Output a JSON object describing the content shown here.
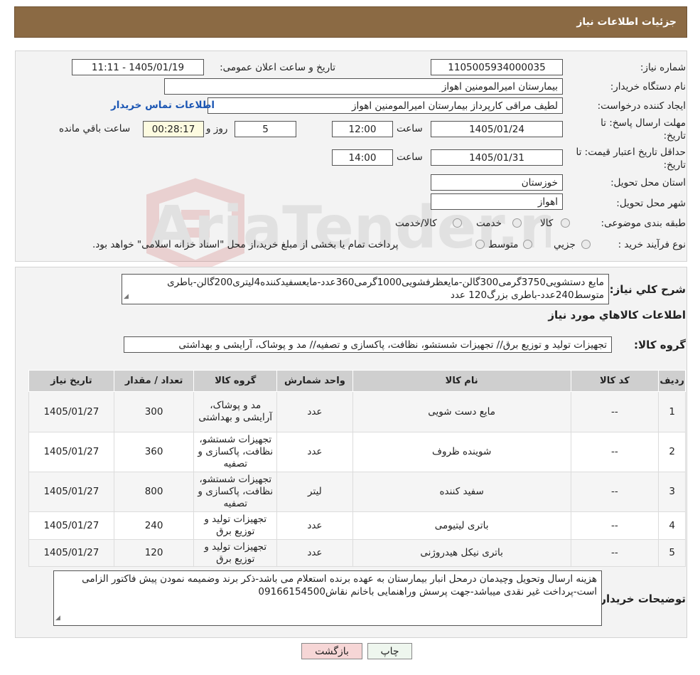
{
  "header": {
    "title": "جزئیات اطلاعات نیاز"
  },
  "form": {
    "need_number_label": "شماره نیاز:",
    "need_number": "1105005934000035",
    "announce_label": "تاریخ و ساعت اعلان عمومی:",
    "announce_value": "1405/01/19 - 11:11",
    "buyer_org_label": "نام دستگاه خریدار:",
    "buyer_org": "بیمارستان امیرالمومنین اهواز",
    "creator_label": "ایجاد کننده درخواست:",
    "creator": "لطیف مراقی کارپرداز بیمارستان امیرالمومنین اهواز",
    "contact_link": "اطلاعات تماس خریدار",
    "deadline_label_1": "مهلت ارسال پاسخ: تا",
    "deadline_label_2": "تاریخ:",
    "deadline_date": "1405/01/24",
    "time_label": "ساعت",
    "deadline_time": "12:00",
    "days_value": "5",
    "days_label": "روز و",
    "remaining_time": "00:28:17",
    "remaining_label": "ساعت باقي مانده",
    "validity_label_1": "حداقل تاریخ اعتبار قیمت: تا",
    "validity_label_2": "تاریخ:",
    "validity_date": "1405/01/31",
    "validity_time": "14:00",
    "province_label": "استان محل تحویل:",
    "province": "خوزستان",
    "city_label": "شهر محل تحویل:",
    "city": "اهواز",
    "category_label": "طبقه بندی موضوعی:",
    "category_options": [
      "کالا",
      "خدمت",
      "کالا/خدمت"
    ],
    "process_label": "نوع فرآیند خرید :",
    "process_options": [
      "جزیي",
      "متوسط"
    ],
    "process_note": "پرداخت تمام یا بخشی از مبلغ خرید،از محل \"اسناد خزانه اسلامی\" خواهد بود."
  },
  "summary": {
    "label": "شرح کلي نياز:",
    "text": "مایع دستشویی3750گرمی300گالن-مایعظرفشویی1000گرمی360عدد-مایعسفیدکننده4لیتری200گالن-باطری متوسط240عدد-باطری بزرگ120 عدد"
  },
  "goods": {
    "section_title": "اطلاعات کالاهاي مورد نياز",
    "group_label": "گروه کالا:",
    "group_value": "تجهیزات تولید و توزیع برق// تجهیزات شستشو، نظافت، پاکسازی و تصفیه// مد و پوشاک، آرایشی و بهداشتی",
    "columns": [
      "ردیف",
      "کد کالا",
      "نام کالا",
      "واحد شمارش",
      "گروه کالا",
      "تعداد / مقدار",
      "تاریخ نیاز"
    ],
    "rows": [
      {
        "row": "1",
        "code": "--",
        "name": "مایع دست شویی",
        "unit": "عدد",
        "group": "مد و پوشاک، آرایشی و بهداشتی",
        "qty": "300",
        "date": "1405/01/27"
      },
      {
        "row": "2",
        "code": "--",
        "name": "شوینده ظروف",
        "unit": "عدد",
        "group": "تجهیزات شستشو، نظافت، پاکسازی و تصفیه",
        "qty": "360",
        "date": "1405/01/27"
      },
      {
        "row": "3",
        "code": "--",
        "name": "سفید کننده",
        "unit": "لیتر",
        "group": "تجهیزات شستشو، نظافت، پاکسازی و تصفیه",
        "qty": "800",
        "date": "1405/01/27"
      },
      {
        "row": "4",
        "code": "--",
        "name": "باتری لیتیومی",
        "unit": "عدد",
        "group": "تجهیزات تولید و توزیع برق",
        "qty": "240",
        "date": "1405/01/27"
      },
      {
        "row": "5",
        "code": "--",
        "name": "باتری نیکل هیدروژنی",
        "unit": "عدد",
        "group": "تجهیزات تولید و توزیع برق",
        "qty": "120",
        "date": "1405/01/27"
      }
    ],
    "buyer_notes_label": "توضیحات خریدار:",
    "buyer_notes": "هزینه ارسال وتحویل وچیدمان درمحل انبار بیمارستان به عهده برنده استعلام می باشد-ذکر برند وضمیمه نمودن پیش فاکتور الزامی است-پرداخت غیر نقدی میباشد-جهت پرسش وراهنمایی باخانم نقاش09166154500"
  },
  "buttons": {
    "print": "چاپ",
    "back": "بازگشت"
  },
  "colors": {
    "header": "#8b6a44",
    "link": "#1a55b3",
    "back_button": "#f6d6d6"
  }
}
